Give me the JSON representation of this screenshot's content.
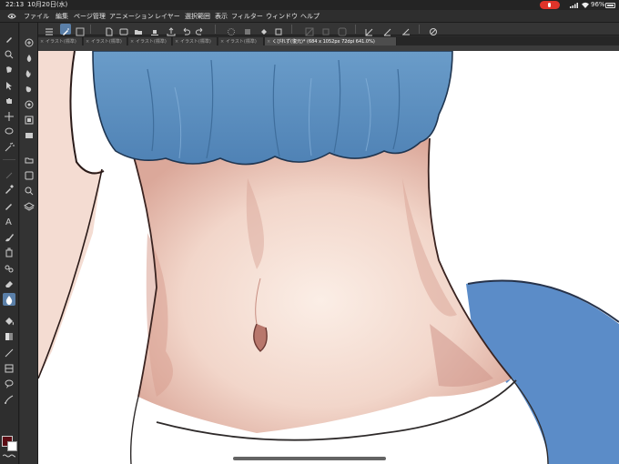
{
  "status_bar": {
    "time": "22:13",
    "date": "10月20日(水)",
    "battery": "96%",
    "mic_color": "#e0342a"
  },
  "menu": {
    "items": [
      "ファイル",
      "編集",
      "ページ管理",
      "アニメーション",
      "レイヤー",
      "選択範囲",
      "表示",
      "フィルター",
      "ウィンドウ",
      "ヘルプ"
    ]
  },
  "tabs": [
    {
      "label": "イラスト(標準)",
      "active": false
    },
    {
      "label": "イラスト(標準)",
      "active": false
    },
    {
      "label": "イラスト(標準)",
      "active": false
    },
    {
      "label": "イラスト(標準)",
      "active": false
    },
    {
      "label": "イラスト(標準)",
      "active": false
    },
    {
      "label": "くびれず(復元)* (684 x 1052px 72dpi 641.0%)",
      "active": true
    }
  ],
  "colors": {
    "accent": "#5a7fa8",
    "main_color": "#5c0d14",
    "sub_color": "#ffffff",
    "shirt": "#5b8ec0",
    "skin": "#f3d7cc"
  },
  "icons": {
    "toolbar": [
      "zoom-icon",
      "move-icon",
      "operation-icon",
      "select-icon",
      "auto-select-icon",
      "eyedropper-icon",
      "pen-icon",
      "pencil-icon",
      "brush-icon",
      "airbrush-icon",
      "decoration-icon",
      "eraser-icon",
      "blend-icon",
      "fill-icon",
      "gradient-icon",
      "figure-icon",
      "frame-icon",
      "ruler-icon",
      "text-icon",
      "balloon-icon",
      "correct-line-icon"
    ]
  }
}
